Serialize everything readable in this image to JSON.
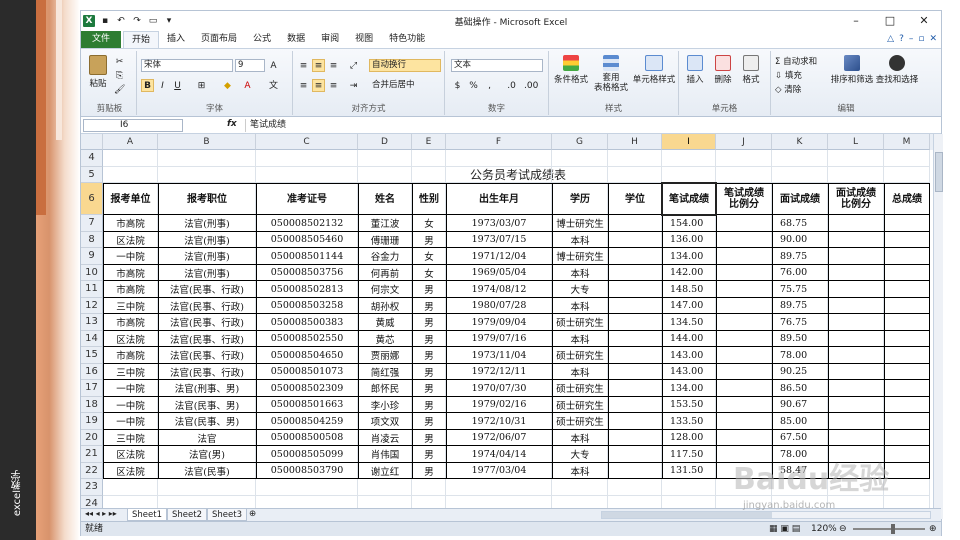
{
  "side": {
    "label": "excel教学"
  },
  "window": {
    "title": "基础操作 - Microsoft Excel"
  },
  "tabs": {
    "file": "文件",
    "items": [
      "开始",
      "插入",
      "页面布局",
      "公式",
      "数据",
      "审阅",
      "视图",
      "特色功能"
    ],
    "active": 0
  },
  "ribbon": {
    "clipboard": {
      "label": "剪贴板",
      "paste": "粘贴"
    },
    "font": {
      "label": "字体",
      "name": "宋体",
      "size": "9",
      "bold": "B",
      "italic": "I",
      "underline": "U"
    },
    "align": {
      "label": "对齐方式",
      "wrap": "自动换行",
      "merge": "合并后居中"
    },
    "number": {
      "label": "数字",
      "format": "文本"
    },
    "styles": {
      "label": "样式",
      "cond": "条件格式",
      "table": "套用\n表格格式",
      "cell": "单元格样式"
    },
    "cells": {
      "label": "单元格",
      "insert": "插入",
      "delete": "删除",
      "format": "格式"
    },
    "edit": {
      "label": "编辑",
      "autosum": "自动求和",
      "fill": "填充",
      "clear": "清除",
      "sort": "排序和筛选",
      "find": "查找和选择"
    }
  },
  "formula_bar": {
    "name_box": "I6",
    "fx": "fx",
    "content": "笔试成绩"
  },
  "columns": [
    "A",
    "B",
    "C",
    "D",
    "E",
    "F",
    "G",
    "H",
    "I",
    "J",
    "K",
    "L",
    "M"
  ],
  "rows": [
    "4",
    "5",
    "6",
    "7",
    "8",
    "9",
    "10",
    "11",
    "12",
    "13",
    "14",
    "15",
    "16",
    "17",
    "18",
    "19",
    "20",
    "21",
    "22",
    "23",
    "24"
  ],
  "sheet_title": "公务员考试成绩表",
  "headers": [
    "报考单位",
    "报考职位",
    "准考证号",
    "姓名",
    "性别",
    "出生年月",
    "学历",
    "学位",
    "笔试成绩",
    "笔试成绩\n比例分",
    "面试成绩",
    "面试成绩\n比例分",
    "总成绩"
  ],
  "records": [
    [
      "市高院",
      "法官(刑事)",
      "050008502132",
      "董江波",
      "女",
      "1973/03/07",
      "博士研究生",
      "",
      "154.00",
      "",
      "68.75",
      "",
      ""
    ],
    [
      "区法院",
      "法官(刑事)",
      "050008505460",
      "傅珊珊",
      "男",
      "1973/07/15",
      "本科",
      "",
      "136.00",
      "",
      "90.00",
      "",
      ""
    ],
    [
      "一中院",
      "法官(刑事)",
      "050008501144",
      "谷金力",
      "女",
      "1971/12/04",
      "博士研究生",
      "",
      "134.00",
      "",
      "89.75",
      "",
      ""
    ],
    [
      "市高院",
      "法官(刑事)",
      "050008503756",
      "何再前",
      "女",
      "1969/05/04",
      "本科",
      "",
      "142.00",
      "",
      "76.00",
      "",
      ""
    ],
    [
      "市高院",
      "法官(民事、行政)",
      "050008502813",
      "何宗文",
      "男",
      "1974/08/12",
      "大专",
      "",
      "148.50",
      "",
      "75.75",
      "",
      ""
    ],
    [
      "三中院",
      "法官(民事、行政)",
      "050008503258",
      "胡孙权",
      "男",
      "1980/07/28",
      "本科",
      "",
      "147.00",
      "",
      "89.75",
      "",
      ""
    ],
    [
      "市高院",
      "法官(民事、行政)",
      "050008500383",
      "黄威",
      "男",
      "1979/09/04",
      "硕士研究生",
      "",
      "134.50",
      "",
      "76.75",
      "",
      ""
    ],
    [
      "区法院",
      "法官(民事、行政)",
      "050008502550",
      "黄芯",
      "男",
      "1979/07/16",
      "本科",
      "",
      "144.00",
      "",
      "89.50",
      "",
      ""
    ],
    [
      "市高院",
      "法官(民事、行政)",
      "050008504650",
      "贾丽娜",
      "男",
      "1973/11/04",
      "硕士研究生",
      "",
      "143.00",
      "",
      "78.00",
      "",
      ""
    ],
    [
      "三中院",
      "法官(民事、行政)",
      "050008501073",
      "简红强",
      "男",
      "1972/12/11",
      "本科",
      "",
      "143.00",
      "",
      "90.25",
      "",
      ""
    ],
    [
      "一中院",
      "法官(刑事、男)",
      "050008502309",
      "郎怀民",
      "男",
      "1970/07/30",
      "硕士研究生",
      "",
      "134.00",
      "",
      "86.50",
      "",
      ""
    ],
    [
      "一中院",
      "法官(民事、男)",
      "050008501663",
      "李小珍",
      "男",
      "1979/02/16",
      "硕士研究生",
      "",
      "153.50",
      "",
      "90.67",
      "",
      ""
    ],
    [
      "一中院",
      "法官(民事、男)",
      "050008504259",
      "项文双",
      "男",
      "1972/10/31",
      "硕士研究生",
      "",
      "133.50",
      "",
      "85.00",
      "",
      ""
    ],
    [
      "三中院",
      "法官",
      "050008500508",
      "肖凌云",
      "男",
      "1972/06/07",
      "本科",
      "",
      "128.00",
      "",
      "67.50",
      "",
      ""
    ],
    [
      "区法院",
      "法官(男)",
      "050008505099",
      "肖伟国",
      "男",
      "1974/04/14",
      "大专",
      "",
      "117.50",
      "",
      "78.00",
      "",
      ""
    ],
    [
      "区法院",
      "法官(民事)",
      "050008503790",
      "谢立红",
      "男",
      "1977/03/04",
      "本科",
      "",
      "131.50",
      "",
      "58.47",
      "",
      ""
    ]
  ],
  "sheet_tabs": [
    "Sheet1",
    "Sheet2",
    "Sheet3"
  ],
  "status": {
    "ready": "就绪",
    "zoom": "120%"
  },
  "watermark": {
    "text": "Baidu经验",
    "url": "jingyan.baidu.com"
  },
  "colors": {
    "file_tab": "#2e7d32",
    "selection": "#f9d890"
  }
}
